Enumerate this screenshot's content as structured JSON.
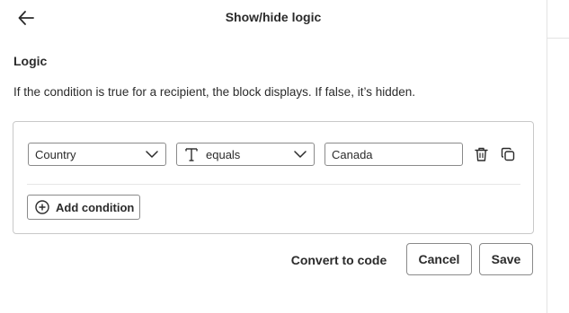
{
  "header": {
    "title": "Show/hide logic",
    "back_icon": "arrow-left-icon"
  },
  "logic": {
    "heading": "Logic",
    "description": "If the condition is true for a recipient, the block displays. If false, it’s hidden."
  },
  "condition": {
    "field_value": "Country",
    "operator_value": "equals",
    "operator_type_icon": "text-type-icon",
    "comparison_value": "Canada",
    "delete_icon": "trash-icon",
    "duplicate_icon": "copy-icon",
    "add_label": "Add condition",
    "add_icon": "plus-circle-icon"
  },
  "footer": {
    "convert_label": "Convert to code",
    "cancel_label": "Cancel",
    "save_label": "Save"
  }
}
